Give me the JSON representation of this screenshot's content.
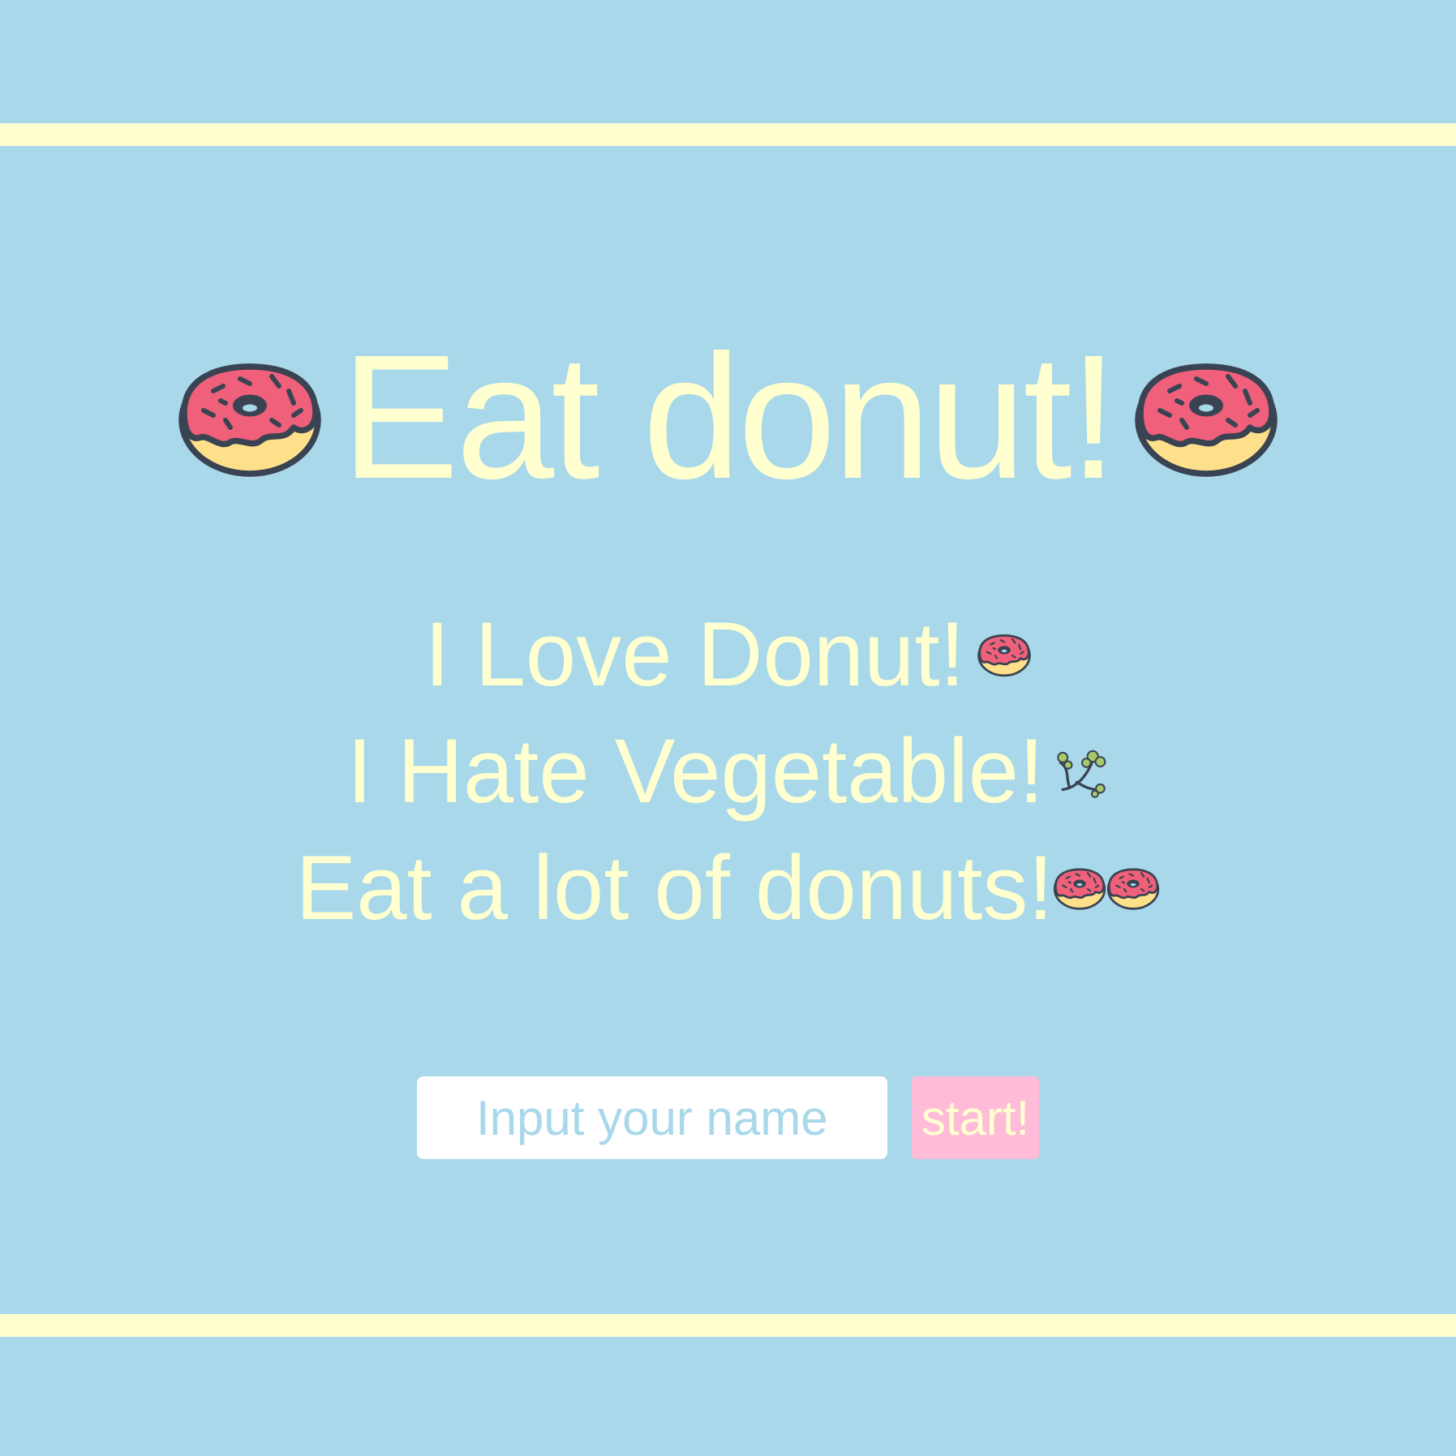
{
  "header": {
    "title": "Eat donut!",
    "left_icon": "donut-icon",
    "right_icon": "donut-icon"
  },
  "lines": [
    {
      "text": "I Love Donut!",
      "icons": [
        "donut-icon"
      ]
    },
    {
      "text": "I Hate Vegetable!",
      "icons": [
        "herb-icon"
      ]
    },
    {
      "text": "Eat a lot of donuts!",
      "icons": [
        "donut-icon",
        "donut-icon"
      ]
    }
  ],
  "form": {
    "name_placeholder": "Input your name",
    "name_value": "",
    "start_label": "start!"
  },
  "colors": {
    "background": "#a8d8ea",
    "text": "#ffffd0",
    "stripe": "#ffffd0",
    "button": "#ffbcd8",
    "input": "#ffffff"
  }
}
